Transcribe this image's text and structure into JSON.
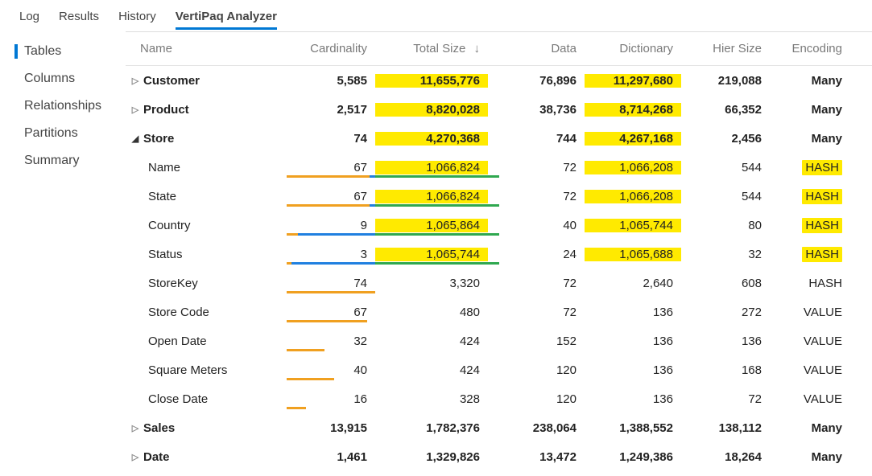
{
  "top_tabs": {
    "log": "Log",
    "results": "Results",
    "history": "History",
    "analyzer": "VertiPaq Analyzer"
  },
  "sidebar": {
    "tables": "Tables",
    "columns": "Columns",
    "relationships": "Relationships",
    "partitions": "Partitions",
    "summary": "Summary"
  },
  "headers": {
    "name": "Name",
    "card": "Cardinality",
    "tsz": "Total Size",
    "data": "Data",
    "dic": "Dictionary",
    "hier": "Hier Size",
    "enc": "Encoding",
    "sort": "↓"
  },
  "rows": {
    "customer": {
      "name": "Customer",
      "card": "5,585",
      "tsz": "11,655,776",
      "data": "76,896",
      "dic": "11,297,680",
      "hier": "219,088",
      "enc": "Many"
    },
    "product": {
      "name": "Product",
      "card": "2,517",
      "tsz": "8,820,028",
      "data": "38,736",
      "dic": "8,714,268",
      "hier": "66,352",
      "enc": "Many"
    },
    "store": {
      "name": "Store",
      "card": "74",
      "tsz": "4,270,368",
      "data": "744",
      "dic": "4,267,168",
      "hier": "2,456",
      "enc": "Many"
    },
    "st_name": {
      "name": "Name",
      "card": "67",
      "tsz": "1,066,824",
      "data": "72",
      "dic": "1,066,208",
      "hier": "544",
      "enc": "HASH"
    },
    "st_state": {
      "name": "State",
      "card": "67",
      "tsz": "1,066,824",
      "data": "72",
      "dic": "1,066,208",
      "hier": "544",
      "enc": "HASH"
    },
    "st_ctry": {
      "name": "Country",
      "card": "9",
      "tsz": "1,065,864",
      "data": "40",
      "dic": "1,065,744",
      "hier": "80",
      "enc": "HASH"
    },
    "st_status": {
      "name": "Status",
      "card": "3",
      "tsz": "1,065,744",
      "data": "24",
      "dic": "1,065,688",
      "hier": "32",
      "enc": "HASH"
    },
    "st_key": {
      "name": "StoreKey",
      "card": "74",
      "tsz": "3,320",
      "data": "72",
      "dic": "2,640",
      "hier": "608",
      "enc": "HASH"
    },
    "st_code": {
      "name": "Store Code",
      "card": "67",
      "tsz": "480",
      "data": "72",
      "dic": "136",
      "hier": "272",
      "enc": "VALUE"
    },
    "st_open": {
      "name": "Open Date",
      "card": "32",
      "tsz": "424",
      "data": "152",
      "dic": "136",
      "hier": "136",
      "enc": "VALUE"
    },
    "st_sqm": {
      "name": "Square Meters",
      "card": "40",
      "tsz": "424",
      "data": "120",
      "dic": "136",
      "hier": "168",
      "enc": "VALUE"
    },
    "st_close": {
      "name": "Close Date",
      "card": "16",
      "tsz": "328",
      "data": "120",
      "dic": "136",
      "hier": "72",
      "enc": "VALUE"
    },
    "sales": {
      "name": "Sales",
      "card": "13,915",
      "tsz": "1,782,376",
      "data": "238,064",
      "dic": "1,388,552",
      "hier": "138,112",
      "enc": "Many"
    },
    "date": {
      "name": "Date",
      "card": "1,461",
      "tsz": "1,329,826",
      "data": "13,472",
      "dic": "1,249,386",
      "hier": "18,264",
      "enc": "Many"
    }
  },
  "glyphs": {
    "collapsed": "▷",
    "expanded": "◢"
  }
}
